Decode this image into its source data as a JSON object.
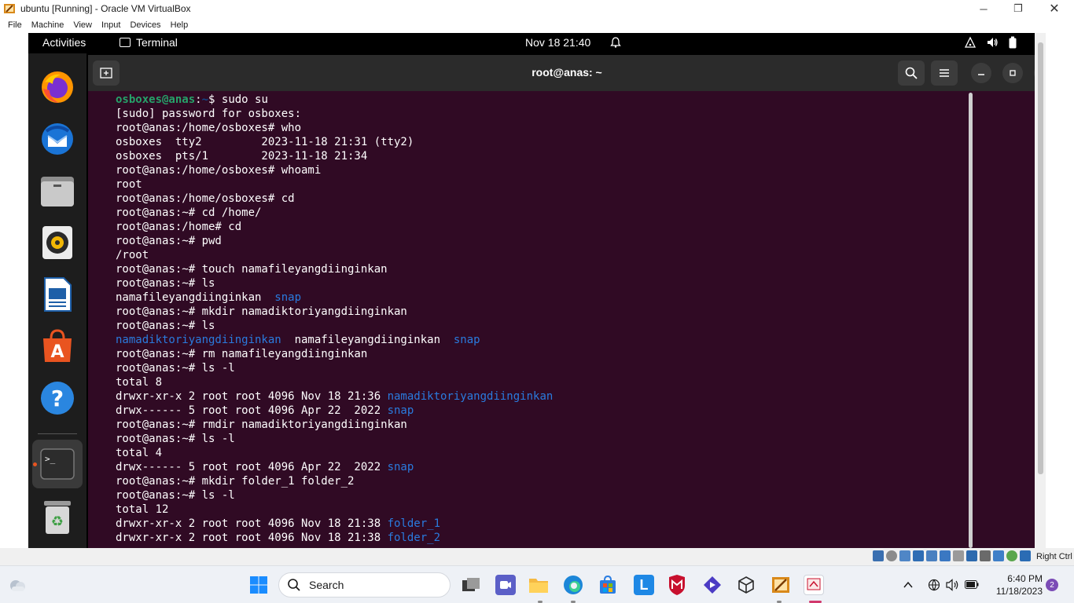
{
  "vbox": {
    "title": "ubuntu [Running] - Oracle VM VirtualBox",
    "menu": [
      "File",
      "Machine",
      "View",
      "Input",
      "Devices",
      "Help"
    ],
    "host_key_label": "Right Ctrl"
  },
  "gnome": {
    "activities": "Activities",
    "app_name": "Terminal",
    "clock": "Nov 18  21:40",
    "dock_items": [
      "firefox-icon",
      "thunderbird-icon",
      "files-icon",
      "rhythmbox-icon",
      "libreoffice-writer-icon",
      "ubuntu-software-icon",
      "help-icon",
      "terminal-icon",
      "trash-icon"
    ]
  },
  "terminal": {
    "title": "root@anas: ~",
    "lines": [
      {
        "parts": [
          {
            "t": "osboxes@anas",
            "c": "user"
          },
          {
            "t": ":",
            "c": ""
          },
          {
            "t": "~",
            "c": "path"
          },
          {
            "t": "$ sudo su",
            "c": ""
          }
        ]
      },
      {
        "parts": [
          {
            "t": "[sudo] password for osboxes:",
            "c": ""
          }
        ]
      },
      {
        "parts": [
          {
            "t": "root@anas:/home/osboxes# who",
            "c": ""
          }
        ]
      },
      {
        "parts": [
          {
            "t": "osboxes  tty2         2023-11-18 21:31 (tty2)",
            "c": ""
          }
        ]
      },
      {
        "parts": [
          {
            "t": "osboxes  pts/1        2023-11-18 21:34",
            "c": ""
          }
        ]
      },
      {
        "parts": [
          {
            "t": "root@anas:/home/osboxes# whoami",
            "c": ""
          }
        ]
      },
      {
        "parts": [
          {
            "t": "root",
            "c": ""
          }
        ]
      },
      {
        "parts": [
          {
            "t": "root@anas:/home/osboxes# cd",
            "c": ""
          }
        ]
      },
      {
        "parts": [
          {
            "t": "root@anas:~# cd /home/",
            "c": ""
          }
        ]
      },
      {
        "parts": [
          {
            "t": "root@anas:/home# cd",
            "c": ""
          }
        ]
      },
      {
        "parts": [
          {
            "t": "root@anas:~# pwd",
            "c": ""
          }
        ]
      },
      {
        "parts": [
          {
            "t": "/root",
            "c": ""
          }
        ]
      },
      {
        "parts": [
          {
            "t": "root@anas:~# touch namafileyangdiinginkan",
            "c": ""
          }
        ]
      },
      {
        "parts": [
          {
            "t": "root@anas:~# ls",
            "c": ""
          }
        ]
      },
      {
        "parts": [
          {
            "t": "namafileyangdiinginkan  ",
            "c": ""
          },
          {
            "t": "snap",
            "c": "dir"
          }
        ]
      },
      {
        "parts": [
          {
            "t": "root@anas:~# mkdir namadiktoriyangdiinginkan",
            "c": ""
          }
        ]
      },
      {
        "parts": [
          {
            "t": "root@anas:~# ls",
            "c": ""
          }
        ]
      },
      {
        "parts": [
          {
            "t": "namadiktoriyangdiinginkan",
            "c": "dir"
          },
          {
            "t": "  namafileyangdiinginkan  ",
            "c": ""
          },
          {
            "t": "snap",
            "c": "dir"
          }
        ]
      },
      {
        "parts": [
          {
            "t": "root@anas:~# rm namafileyangdiinginkan",
            "c": ""
          }
        ]
      },
      {
        "parts": [
          {
            "t": "root@anas:~# ls -l",
            "c": ""
          }
        ]
      },
      {
        "parts": [
          {
            "t": "total 8",
            "c": ""
          }
        ]
      },
      {
        "parts": [
          {
            "t": "drwxr-xr-x 2 root root 4096 Nov 18 21:36 ",
            "c": ""
          },
          {
            "t": "namadiktoriyangdiinginkan",
            "c": "dir"
          }
        ]
      },
      {
        "parts": [
          {
            "t": "drwx------ 5 root root 4096 Apr 22  2022 ",
            "c": ""
          },
          {
            "t": "snap",
            "c": "dir"
          }
        ]
      },
      {
        "parts": [
          {
            "t": "root@anas:~# rmdir namadiktoriyangdiinginkan",
            "c": ""
          }
        ]
      },
      {
        "parts": [
          {
            "t": "root@anas:~# ls -l",
            "c": ""
          }
        ]
      },
      {
        "parts": [
          {
            "t": "total 4",
            "c": ""
          }
        ]
      },
      {
        "parts": [
          {
            "t": "drwx------ 5 root root 4096 Apr 22  2022 ",
            "c": ""
          },
          {
            "t": "snap",
            "c": "dir"
          }
        ]
      },
      {
        "parts": [
          {
            "t": "root@anas:~# mkdir folder_1 folder_2",
            "c": ""
          }
        ]
      },
      {
        "parts": [
          {
            "t": "root@anas:~# ls -l",
            "c": ""
          }
        ]
      },
      {
        "parts": [
          {
            "t": "total 12",
            "c": ""
          }
        ]
      },
      {
        "parts": [
          {
            "t": "drwxr-xr-x 2 root root 4096 Nov 18 21:38 ",
            "c": ""
          },
          {
            "t": "folder_1",
            "c": "dir"
          }
        ]
      },
      {
        "parts": [
          {
            "t": "drwxr-xr-x 2 root root 4096 Nov 18 21:38 ",
            "c": ""
          },
          {
            "t": "folder_2",
            "c": "dir"
          }
        ]
      }
    ]
  },
  "taskbar": {
    "search_label": "Search",
    "time": "6:40 PM",
    "date": "11/18/2023",
    "notification_count": "2"
  }
}
